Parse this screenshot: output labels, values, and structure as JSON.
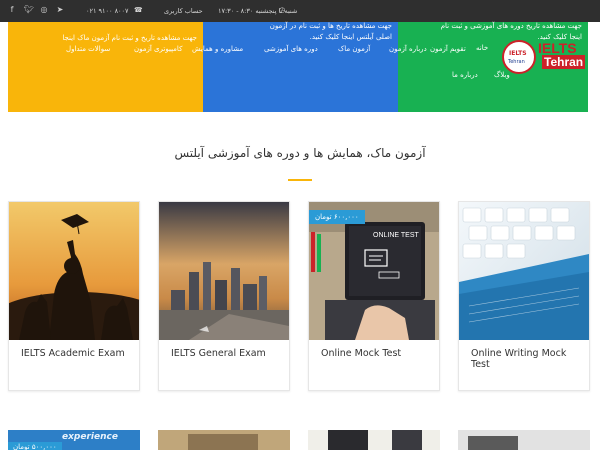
{
  "topbar": {
    "hours": "شنبه تا پنجشنبه ۸:۳۰ - ۱۷:۳۰",
    "account": "حساب کاربری",
    "phone": "۰۲۱ ۹۱۰۰ ۸۰۰۷"
  },
  "banner": {
    "yellow_text": "جهت مشاهده تاریخ و ثبت نام آزمون ماک اینجا",
    "blue_text_1": "جهت مشاهده تاریخ ها و ثبت نام در آزمون",
    "blue_text_2": "اصلی آیلتس اینجا کلیک کنید.",
    "green_text_1": "جهت مشاهده تاریخ دوره های آموزشی و ثبت نام",
    "green_text_2": "اینجا کلیک کنید."
  },
  "nav": {
    "home": "خانه",
    "calendar": "تقویم آزمون",
    "about_exam": "درباره آزمون",
    "mock": "آزمون ماک",
    "courses": "دوره های آموزشی",
    "consult": "مشاوره و همایش",
    "cbt": "کامپیوتری آزمون",
    "faq": "سوالات متداول",
    "blog": "وبلاگ",
    "about_us": "درباره ما"
  },
  "logo": {
    "circle_top": "IELTS",
    "circle_bottom": "Tehran",
    "word_top": "IELTS",
    "word_bottom": "Tehran"
  },
  "section": {
    "heading": "آزمون ماک، همایش ها و دوره های آموزشی آیلتس"
  },
  "cards": [
    {
      "title": "IELTS Academic Exam"
    },
    {
      "title": "IELTS General Exam"
    },
    {
      "title": "Online Mock Test",
      "price": "۶۰۰,۰۰۰ تومان",
      "screen_text": "ONLINE TEST"
    },
    {
      "title": "Online Writing Mock Test"
    }
  ],
  "row2": {
    "price": "۵۰۰,۰۰۰ تومان",
    "banner_text": "experience"
  },
  "colors": {
    "yellow": "#f9b50a",
    "blue": "#2b74d8",
    "green": "#18b152",
    "topbar": "#2f2f2f",
    "price_badge": "#2b9bd6",
    "brand_red": "#cc2229"
  }
}
